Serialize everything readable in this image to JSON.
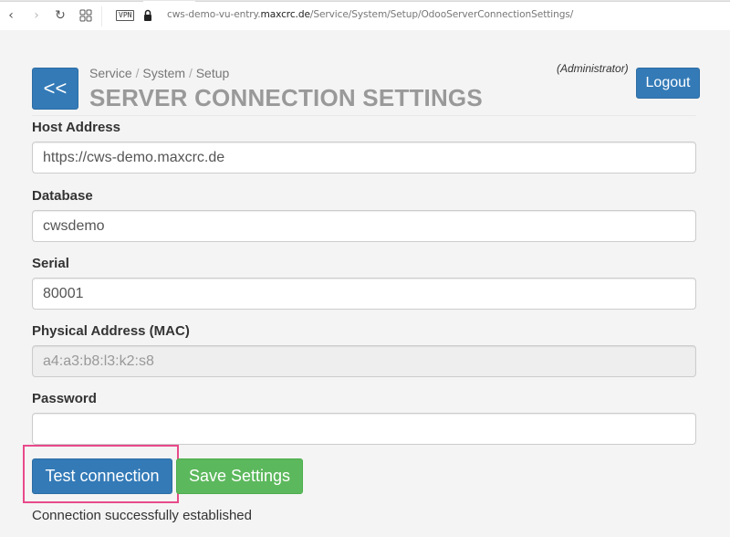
{
  "browser": {
    "vpn_label": "VPN",
    "url_prefix": "cws-demo-vu-entry.",
    "url_host": "maxcrc.de",
    "url_path": "/Service/System/Setup/OdooServerConnectionSettings/",
    "icons": {
      "back": "‹",
      "forward": "›",
      "reload": "↻",
      "grid": "▦"
    }
  },
  "header": {
    "back_label": "<<",
    "breadcrumb": [
      "Service",
      "System",
      "Setup"
    ],
    "breadcrumb_separator": "/",
    "title": "SERVER CONNECTION SETTINGS",
    "user_role": "(Administrator)",
    "logout_label": "Logout"
  },
  "form": {
    "host_address": {
      "label": "Host Address",
      "value": "https://cws-demo.maxcrc.de"
    },
    "database": {
      "label": "Database",
      "value": "cwsdemo"
    },
    "serial": {
      "label": "Serial",
      "value": "80001"
    },
    "mac": {
      "label": "Physical Address (MAC)",
      "value": "a4:a3:b8:l3:k2:s8"
    },
    "password": {
      "label": "Password",
      "value": ""
    }
  },
  "actions": {
    "test_label": "Test connection",
    "save_label": "Save Settings"
  },
  "status": {
    "message": "Connection successfully established"
  },
  "colors": {
    "primary": "#337ab7",
    "success": "#5cb85c",
    "highlight": "#e84a8a"
  }
}
